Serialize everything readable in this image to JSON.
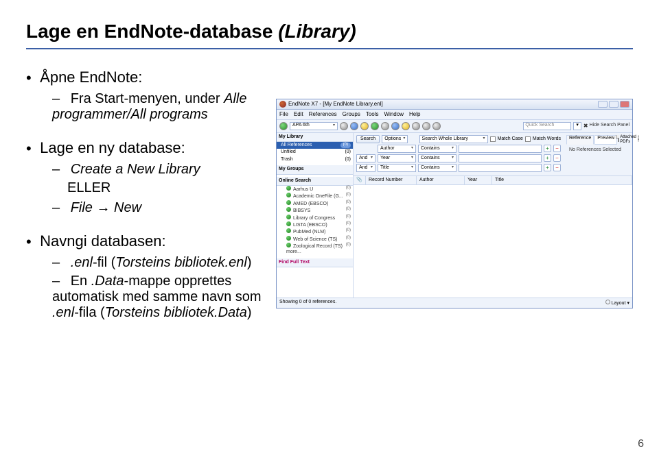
{
  "title": {
    "plain": "Lage en EndNote-database ",
    "italic": "(Library)"
  },
  "bullets": {
    "b1": {
      "top": "Åpne EndNote:",
      "sub1_a": "Fra Start-menyen, under ",
      "sub1_b": "Alle programmer/All programs"
    },
    "b2": {
      "top": "Lage en ny database:",
      "sub1_a": "Create a New Library",
      "sub1_indent": "ELLER",
      "sub2_a": "File ",
      "sub2_arrow": "→",
      "sub2_b": " New"
    },
    "b3": {
      "top": "Navngi databasen:",
      "sub1_a": ".enl",
      "sub1_b": "-fil (",
      "sub1_c": "Torsteins bibliotek.enl",
      "sub1_d": ")",
      "sub2_a": "En ",
      "sub2_b": ".Data",
      "sub2_c": "-mappe opprettes automatisk med samme navn som ",
      "sub2_d": ".enl",
      "sub2_e": "-fila (",
      "sub2_f": "Torsteins bibliotek.Data",
      "sub2_g": ")"
    }
  },
  "page_number": "6",
  "app": {
    "title": "EndNote X7 - [My EndNote Library.enl]",
    "menus": [
      "File",
      "Edit",
      "References",
      "Groups",
      "Tools",
      "Window",
      "Help"
    ],
    "quick_search": "Quick Search",
    "hide_panel": "Hide Search Panel",
    "sidebar": {
      "my_library": "My Library",
      "all_refs": "All References",
      "all_count": "(0)",
      "unfiled": "Unfiled",
      "unfiled_count": "(0)",
      "trash": "Trash",
      "trash_count": "(0)",
      "my_groups": "My Groups",
      "online_head": "Online Search",
      "providers": [
        {
          "name": "Aarhus U",
          "count": "(0)"
        },
        {
          "name": "Academic OneFile (G...",
          "count": "(0)"
        },
        {
          "name": "AMED (EBSCO)",
          "count": "(0)"
        },
        {
          "name": "BIBSYS",
          "count": "(0)"
        },
        {
          "name": "Library of Congress",
          "count": "(0)"
        },
        {
          "name": "LISTA (EBSCO)",
          "count": "(0)"
        },
        {
          "name": "PubMed (NLM)",
          "count": "(0)"
        },
        {
          "name": "Web of Science (TS)",
          "count": "(0)"
        },
        {
          "name": "Zoological Record (TS)",
          "count": "(0)"
        }
      ],
      "more": "more...",
      "find_ft": "Find Full Text"
    },
    "search": {
      "search_btn": "Search",
      "options_btn": "Options",
      "scope": "Search Whole Library",
      "match_case": "Match Case",
      "match_words": "Match Words",
      "rows": [
        {
          "bool": "",
          "field": "Author",
          "op": "Contains"
        },
        {
          "bool": "And",
          "field": "Year",
          "op": "Contains"
        },
        {
          "bool": "And",
          "field": "Title",
          "op": "Contains"
        }
      ]
    },
    "rightpane": {
      "tab1": "Reference",
      "tab2": "Preview",
      "attached": "Attached PDFs",
      "msg": "No References Selected"
    },
    "grid": {
      "c1": "",
      "c2": "Record Number",
      "c3": "Author",
      "c4": "Year",
      "c5": "Title"
    },
    "status_left": "Showing 0 of 0 references.",
    "status_right": "Layout"
  }
}
